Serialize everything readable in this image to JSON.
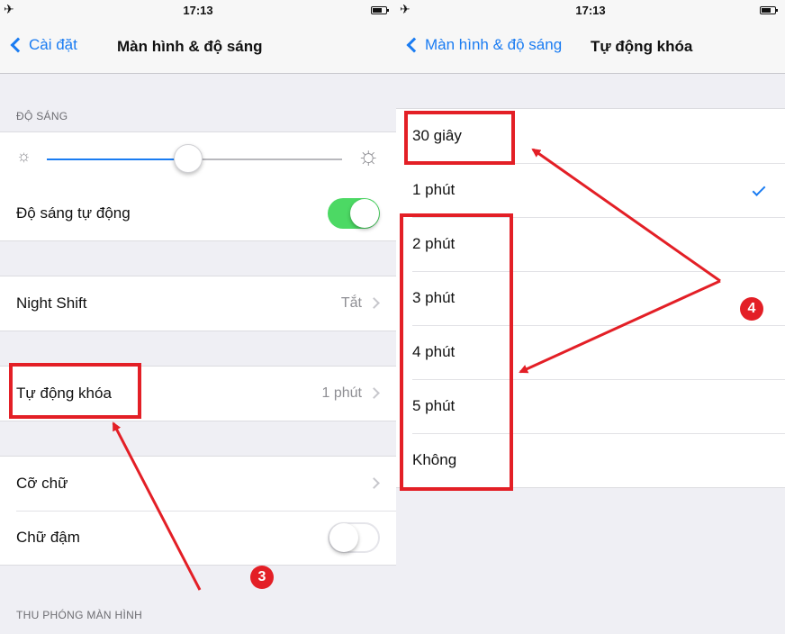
{
  "colors": {
    "accent": "#1a7cf2",
    "toggle_on": "#4cd964",
    "annotation_red": "#e31f26"
  },
  "left": {
    "status": {
      "time": "17:13"
    },
    "nav": {
      "back": "Cài đặt",
      "title": "Màn hình & độ sáng"
    },
    "brightness_header": "ĐỘ SÁNG",
    "brightness_level": 0.48,
    "auto_brightness": {
      "label": "Độ sáng tự động",
      "on": true
    },
    "night_shift": {
      "label": "Night Shift",
      "value": "Tắt"
    },
    "auto_lock": {
      "label": "Tự động khóa",
      "value": "1 phút"
    },
    "text_size": {
      "label": "Cỡ chữ"
    },
    "bold_text": {
      "label": "Chữ đậm",
      "on": false
    },
    "zoom_header": "THU PHÓNG MÀN HÌNH",
    "annotation": "3"
  },
  "right": {
    "status": {
      "time": "17:13"
    },
    "nav": {
      "back": "Màn hình & độ sáng",
      "title": "Tự động khóa"
    },
    "options": [
      {
        "label": "30 giây",
        "selected": false
      },
      {
        "label": "1 phút",
        "selected": true
      },
      {
        "label": "2 phút",
        "selected": false
      },
      {
        "label": "3 phút",
        "selected": false
      },
      {
        "label": "4 phút",
        "selected": false
      },
      {
        "label": "5 phút",
        "selected": false
      },
      {
        "label": "Không",
        "selected": false
      }
    ],
    "annotation": "4"
  }
}
